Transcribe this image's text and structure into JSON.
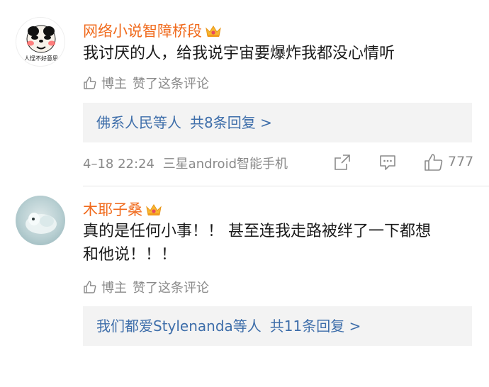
{
  "comments": [
    {
      "username": "网络小说智障桥段",
      "avatar_caption": "人怪不好意思",
      "text": "我讨厌的人，给我说宇宙要爆炸我都没心情听",
      "liked_author": "博主",
      "liked_text": "赞了这条评论",
      "replies_users": "佛系人民等人",
      "replies_count": "共8条回复 >",
      "timestamp": "4–18 22:24",
      "device": "三星android智能手机",
      "like_count": "777"
    },
    {
      "username": "木耶子桑",
      "text_line1": "真的是任何小事！！ 甚至连我走路被绊了一下都想",
      "text_line2": "和他说！！！",
      "liked_author": "博主",
      "liked_text": "赞了这条评论",
      "replies_users": "我们都爱Stylenanda等人",
      "replies_count": "共11条回复 >"
    }
  ],
  "colors": {
    "username": "#f06a1c",
    "link": "#3e6eaa",
    "meta": "#8a8a8a",
    "reply_bg": "#f3f3f3"
  },
  "icons": [
    "crown-icon",
    "thumbs-up-icon",
    "share-icon",
    "comment-icon"
  ]
}
